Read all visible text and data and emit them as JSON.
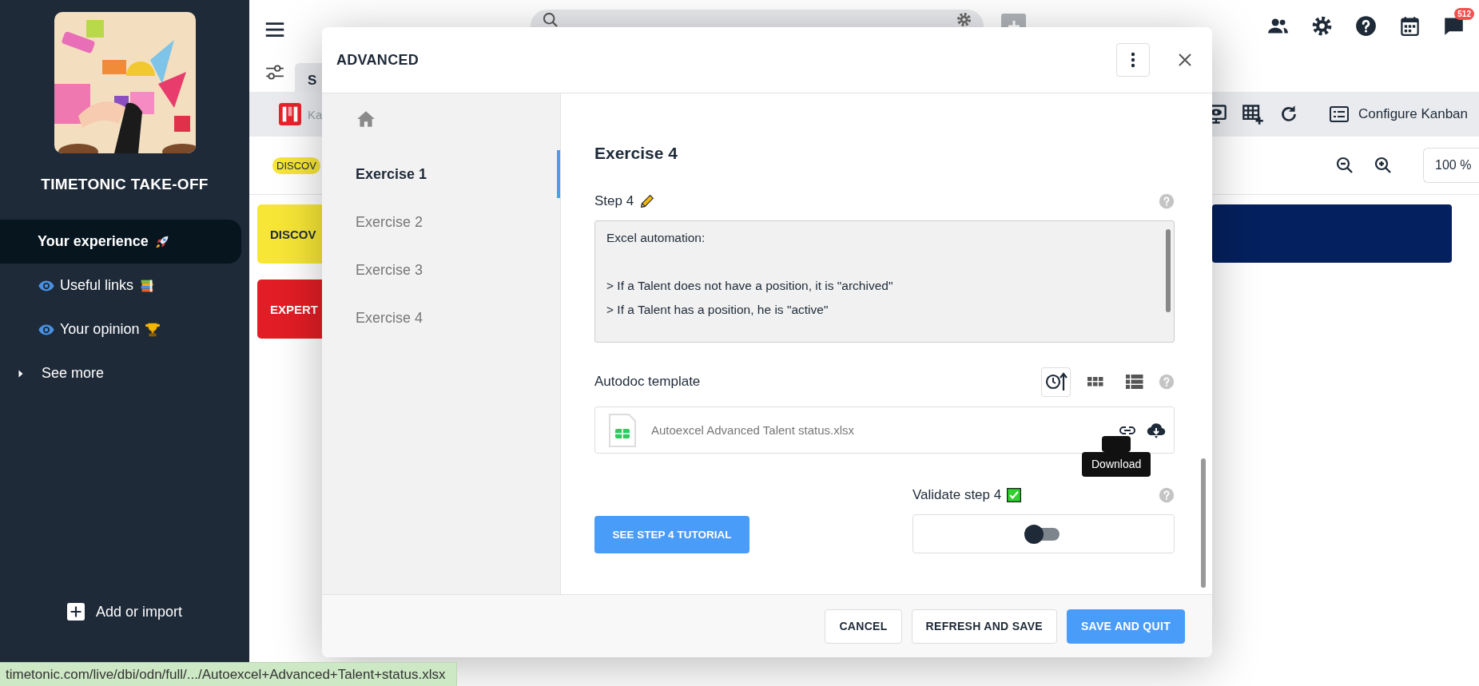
{
  "sidebar": {
    "title": "TIMETONIC TAKE-OFF",
    "items": [
      {
        "label": "Your experience",
        "kind": "rocket",
        "selected": true
      },
      {
        "label": "Useful links",
        "kind": "books",
        "selected": false
      },
      {
        "label": "Your opinion",
        "kind": "trophy",
        "selected": false
      },
      {
        "label": "See more",
        "kind": "expander",
        "selected": false
      }
    ],
    "add_button": "Add or import"
  },
  "top_bar": {
    "notification_count": "512"
  },
  "tab": {
    "label": "S"
  },
  "toolbar": {
    "view_label": "Ka",
    "configure": "Configure Kanban"
  },
  "zoom_level": "100 %",
  "filter_pill": "DISCOV",
  "cards": [
    {
      "label": "DISCOV",
      "color": "#f7e636"
    },
    {
      "label": "EXPERT",
      "color": "#e21d25"
    }
  ],
  "modal": {
    "title": "ADVANCED",
    "nav": [
      {
        "label": "Exercise 1",
        "selected": true
      },
      {
        "label": "Exercise 2",
        "selected": false
      },
      {
        "label": "Exercise 3",
        "selected": false
      },
      {
        "label": "Exercise 4",
        "selected": false
      }
    ],
    "heading": "Exercise 4",
    "step_label": "Step 4",
    "description": {
      "intro": "Excel automation:",
      "rules": [
        "> If a Talent does not have a position, it is \"archived\"",
        "> If a Talent has a position, he is \"active\""
      ]
    },
    "autodoc": {
      "label": "Autodoc template",
      "file": "Autoexcel Advanced Talent status.xlsx",
      "tooltip": "Download"
    },
    "tutorial_button": "SEE STEP 4 TUTORIAL",
    "validate": {
      "label": "Validate step 4",
      "on": false
    },
    "buttons": [
      {
        "label": "CANCEL",
        "kind": "secondary"
      },
      {
        "label": "REFRESH AND SAVE",
        "kind": "secondary"
      },
      {
        "label": "SAVE AND QUIT",
        "kind": "primary"
      }
    ]
  },
  "status_bar": "timetonic.com/live/dbi/odn/full/.../Autoexcel+Advanced+Talent+status.xlsx"
}
